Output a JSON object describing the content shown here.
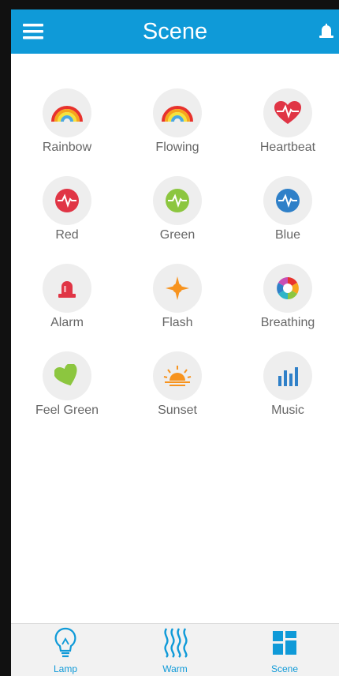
{
  "colors": {
    "accent": "#0f9ad8",
    "circle_bg": "#eeeeee",
    "label_text": "#666666"
  },
  "header": {
    "title": "Scene",
    "menu_icon": "hamburger-menu-icon",
    "alarm_icon": "alarm-bell-icon"
  },
  "scenes": [
    {
      "label": "Rainbow",
      "icon": "rainbow-icon"
    },
    {
      "label": "Flowing",
      "icon": "rainbow-icon"
    },
    {
      "label": "Heartbeat",
      "icon": "heartbeat-icon"
    },
    {
      "label": "Red",
      "icon": "red-pulse-icon"
    },
    {
      "label": "Green",
      "icon": "green-pulse-icon"
    },
    {
      "label": "Blue",
      "icon": "blue-pulse-icon"
    },
    {
      "label": "Alarm",
      "icon": "siren-icon"
    },
    {
      "label": "Flash",
      "icon": "flash-star-icon"
    },
    {
      "label": "Breathing",
      "icon": "breathing-pinwheel-icon"
    },
    {
      "label": "Feel Green",
      "icon": "green-heart-icon"
    },
    {
      "label": "Sunset",
      "icon": "sunset-icon"
    },
    {
      "label": "Music",
      "icon": "music-bars-icon"
    }
  ],
  "tabs": [
    {
      "label": "Lamp",
      "icon": "lightbulb-icon"
    },
    {
      "label": "Warm",
      "icon": "warm-waves-icon"
    },
    {
      "label": "Scene",
      "icon": "scene-grid-icon"
    }
  ]
}
